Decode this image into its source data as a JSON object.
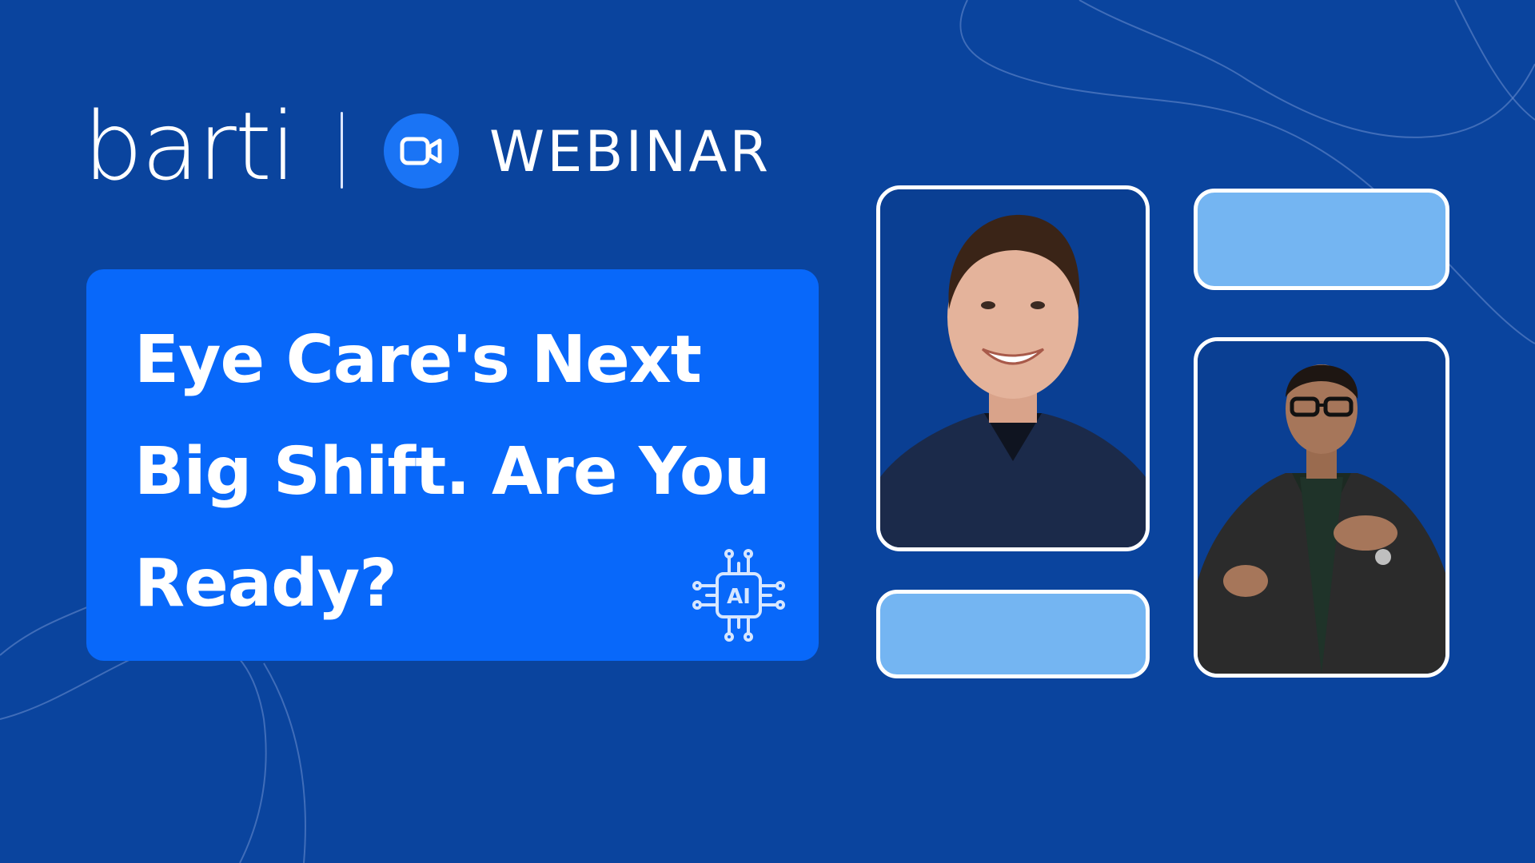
{
  "brand": {
    "logo_text": "barti",
    "badge_icon": "video-camera-icon",
    "label": "WEBINAR"
  },
  "title": {
    "text": "Eye Care's Next Big Shift. Are You Ready?",
    "chip_label": "AI",
    "chip_icon": "ai-chip-icon"
  },
  "colors": {
    "background": "#0a449e",
    "card": "#0868fa",
    "badge": "#1a74f5",
    "placeholder": "#74b5f2",
    "text": "#ffffff"
  },
  "speakers": [
    {
      "icon": "speaker-photo-1"
    },
    {
      "icon": "speaker-photo-2"
    }
  ]
}
